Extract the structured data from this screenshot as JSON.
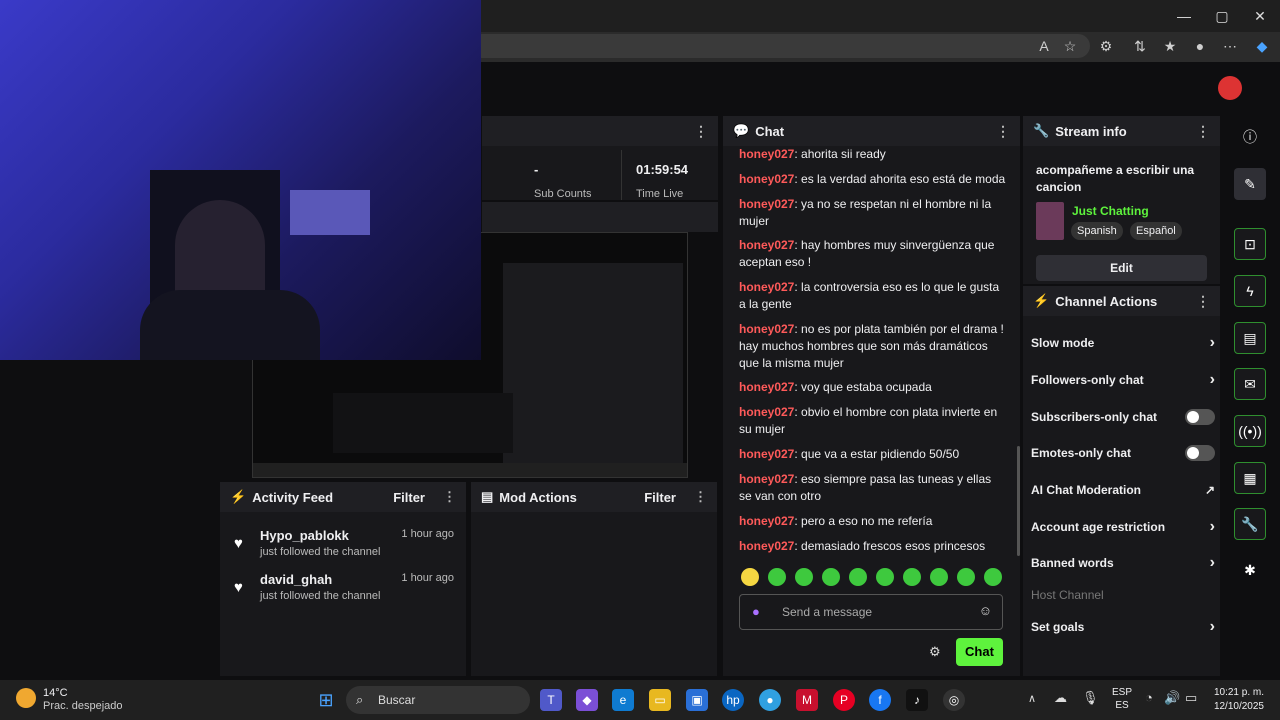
{
  "browser": {
    "window_controls": [
      "—",
      "▢",
      "✕"
    ]
  },
  "stats": {
    "value_1": "-",
    "label_1": "Sub Counts",
    "value_2": "01:59:54",
    "label_2": "Time Live"
  },
  "chat": {
    "title": "Chat",
    "messages": [
      {
        "user": "honey027",
        "text": "ahorita sii ready"
      },
      {
        "user": "honey027",
        "text": "es la verdad ahorita eso está de moda"
      },
      {
        "user": "honey027",
        "text": "ya no se respetan ni el hombre ni la mujer"
      },
      {
        "user": "honey027",
        "text": "hay hombres muy sinvergüenza que aceptan eso !"
      },
      {
        "user": "honey027",
        "text": "la controversia eso es lo que le gusta a la gente"
      },
      {
        "user": "honey027",
        "text": "no es por plata también por el drama ! hay muchos hombres que son más dramáticos que la misma mujer"
      },
      {
        "user": "honey027",
        "text": "voy que estaba ocupada"
      },
      {
        "user": "honey027",
        "text": "obvio el hombre con plata invierte en su mujer"
      },
      {
        "user": "honey027",
        "text": "que va a estar pidiendo 50/50"
      },
      {
        "user": "honey027",
        "text": "eso siempre pasa las tuneas y ellas se van con otro"
      },
      {
        "user": "honey027",
        "text": "pero a eso no me refería"
      },
      {
        "user": "honey027",
        "text": "demasiado frescos esos princesos"
      }
    ],
    "input_placeholder": "Send a message",
    "send_label": "Chat"
  },
  "stream_info": {
    "title": "Stream info",
    "stream_title": "acompañeme a escribir una cancion",
    "category": "Just Chatting",
    "tags": [
      "Spanish",
      "Español"
    ],
    "edit_label": "Edit"
  },
  "channel_actions": {
    "title": "Channel Actions",
    "items": [
      {
        "label": "Slow mode",
        "control": "chevron"
      },
      {
        "label": "Followers-only chat",
        "control": "chevron"
      },
      {
        "label": "Subscribers-only chat",
        "control": "toggle"
      },
      {
        "label": "Emotes-only chat",
        "control": "toggle"
      },
      {
        "label": "AI Chat Moderation",
        "control": "external"
      },
      {
        "label": "Account age restriction",
        "control": "chevron"
      },
      {
        "label": "Banned words",
        "control": "chevron"
      },
      {
        "label": "Host Channel",
        "control": "disabled"
      },
      {
        "label": "Set goals",
        "control": "chevron"
      }
    ]
  },
  "activity_feed": {
    "title": "Activity Feed",
    "filter_label": "Filter",
    "items": [
      {
        "name": "Hypo_pablokk",
        "text": "just followed the channel",
        "time": "1 hour ago"
      },
      {
        "name": "david_ghah",
        "text": "just followed the channel",
        "time": "1 hour ago"
      }
    ]
  },
  "mod_actions": {
    "title": "Mod Actions",
    "filter_label": "Filter"
  },
  "taskbar": {
    "weather_temp": "14°C",
    "weather_desc": "Prac. despejado",
    "search_label": "Buscar",
    "lang_1": "ESP",
    "lang_2": "ES",
    "time": "10:21 p. m.",
    "date": "12/10/2025"
  },
  "colors": {
    "accent_green": "#5ef33d",
    "username_red": "#ff5a5a",
    "panel_bg": "#18181b"
  }
}
